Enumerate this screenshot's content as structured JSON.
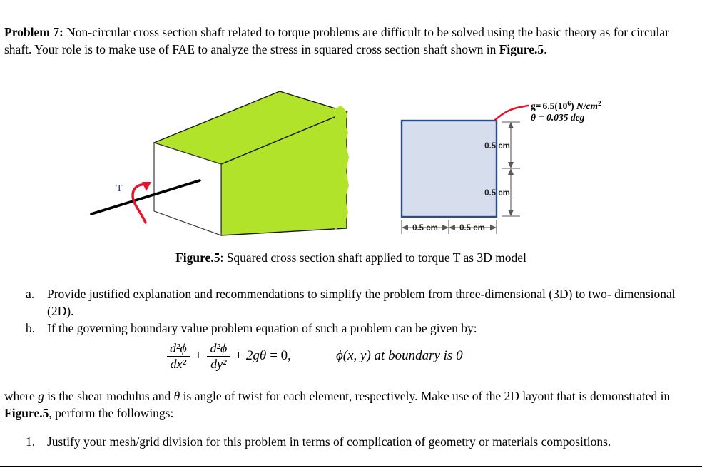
{
  "document": {
    "intro": {
      "label": "Problem 7:",
      "text": " Non-circular cross section shaft related to torque problems are difficult to be solved using the basic theory as for circular shaft. Your role is to make use of FAE to analyze the stress in squared cross section shaft shown in ",
      "figure_ref": "Figure.5",
      "tail": "."
    },
    "figure": {
      "caption_label": "Figure.5",
      "caption_text": ": Squared cross section shaft applied to torque T as 3D model",
      "torque_label": "T",
      "annotation_line1_prefix": "g=",
      "annotation_line1": "6.5(10",
      "annotation_line1_exp": "6",
      "annotation_line1_unit": ") N/cm",
      "annotation_line1_unit_exp": "2",
      "annotation_line2_symbol": "θ",
      "annotation_line2_value": "= 0.035 deg",
      "dim_left": "0.5 cm",
      "dim_right": "0.5 cm",
      "dim_top": "0.5 cm",
      "dim_bottom": "0.5 cm",
      "colors": {
        "shaft_green": "#b0e32a",
        "shaft_outline": "#1a1a1a",
        "square_fill": "#d6dded",
        "square_border": "#2b4c8c",
        "torque_arrow": "#e8122a",
        "torque_label": "#1f3864",
        "axis_line": "#000000",
        "dimension_line": "#595959"
      }
    },
    "letter_list": [
      {
        "marker": "a.",
        "text": "Provide justified explanation and recommendations to simplify the problem from three-dimensional (3D) to two- dimensional (2D)."
      },
      {
        "marker": "b.",
        "text": "If the governing boundary value problem equation of such a problem can be given by:"
      }
    ],
    "equation": {
      "num1": "d²ϕ",
      "den1": "dx²",
      "plus1": "+",
      "num2": "d²ϕ",
      "den2": "dy²",
      "plus2": "+",
      "term3": "2gθ",
      "equals": "= 0,",
      "boundary": "ϕ(x, y) at boundary is 0"
    },
    "where_paragraph": {
      "part1": "where ",
      "g_symbol": "g",
      "part2": " is the shear modulus and ",
      "theta_symbol": "θ",
      "part3": " is angle of twist for each element, respectively. Make use of the 2D layout that is demonstrated in ",
      "figure_ref": "Figure.5",
      "part4": ", perform the followings:"
    },
    "number_list": [
      {
        "marker": "1.",
        "text": "Justify your mesh/grid division for this problem in terms of complication of geometry or materials compositions."
      }
    ]
  }
}
